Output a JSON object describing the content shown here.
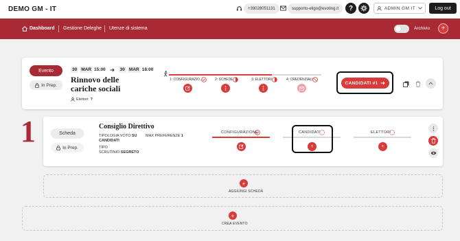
{
  "app": {
    "brand": "DEMO GM - IT"
  },
  "topbar": {
    "phone": "+39028051131",
    "email": "supporto-eligo@evoting.it",
    "help_label": "?",
    "user_label": "ADMIN GM IT",
    "logout_label": "Log out"
  },
  "nav": {
    "items": [
      {
        "label": "Dashboard"
      },
      {
        "label": "Gestione Deleghe"
      },
      {
        "label": "Utenze di sistema"
      }
    ],
    "archivio_label": "Archivio",
    "archivio_on": false
  },
  "event": {
    "type_label": "Evento",
    "status_label": "In Prep.",
    "start_day": "30",
    "start_month": "MAR",
    "start_time": "15:00",
    "end_day": "30",
    "end_month": "MAR",
    "end_time": "18:00",
    "title_line1": "Rinnovo delle",
    "title_line2": "cariche sociali",
    "electors_label": "Elettori:",
    "electors_count": "?",
    "steps": [
      {
        "label": "1: CONFIGURAZIO...",
        "state": "done"
      },
      {
        "label": "2: SCHEDE",
        "state": "partial"
      },
      {
        "label": "3: ELETTORI",
        "state": "partial"
      },
      {
        "label": "4: CREDENZIALI",
        "state": "blocked"
      }
    ],
    "candidates_button": "CANDIDATI #1"
  },
  "ballot": {
    "number": "1",
    "type_label": "Scheda",
    "status_label": "In Prep.",
    "title": "Consiglio Direttivo",
    "vote_type_label": "TIPOLOGIA VOTO",
    "vote_type_value": "SU",
    "vote_type_value2": "CANDIDATI",
    "max_pref_label": "MAX PREFERENZE",
    "max_pref_value": "1",
    "scrutiny_label": "TIPO",
    "scrutiny_label2": "SCRUTINIO",
    "scrutiny_value": "SEGRETO",
    "columns": [
      {
        "label": "CONFIGURAZIONE",
        "state": "done"
      },
      {
        "label": "CANDIDATI",
        "state": "pending"
      },
      {
        "label": "ELETTORI",
        "state": "pending"
      }
    ]
  },
  "actions": {
    "add_ballot": "AGGIUNGI SCHEDA",
    "create_event": "CREA EVENTO"
  },
  "colors": {
    "brand_red": "#a82a35",
    "accent_red": "#d93a3a",
    "dark": "#1e1e1e"
  }
}
